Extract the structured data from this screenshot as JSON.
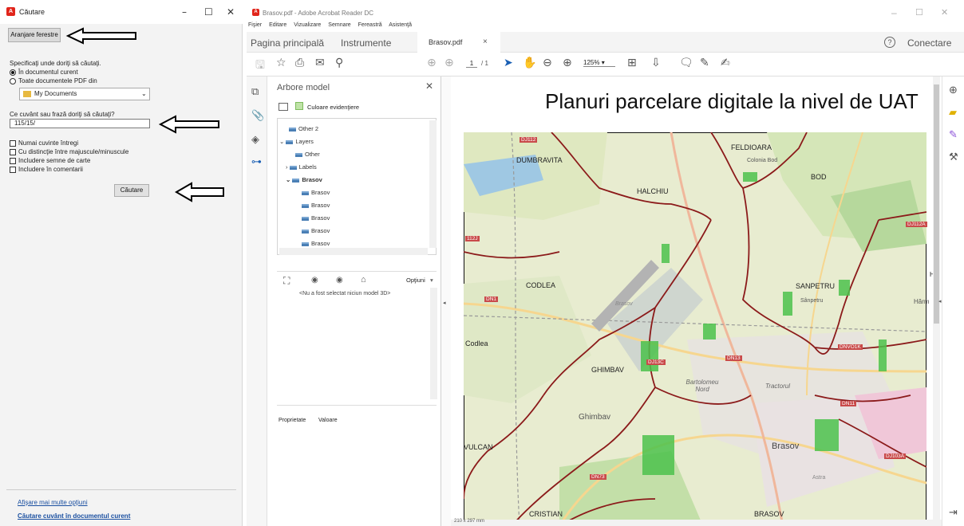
{
  "search": {
    "title": "Căutare",
    "arrange_button": "Aranjare ferestre",
    "where_label": "Specificaţi unde doriţi să căutaţi.",
    "opt_current": "În documentul curent",
    "opt_all_pdfs": "Toate documentele PDF din",
    "folder": "My Documents",
    "query_label": "Ce cuvânt sau frază doriţi să căutaţi?",
    "query_value": "115/15/",
    "chk_whole": "Numai cuvinte întregi",
    "chk_case": "Cu distincţie între majuscule/minuscule",
    "chk_bookmarks": "Includere semne de carte",
    "chk_comments": "Includere în comentarii",
    "search_button": "Căutare",
    "more_options": "Afişare mai multe opţiuni",
    "search_current": "Căutare cuvânt în documentul curent"
  },
  "acrobat": {
    "title": "Brasov.pdf - Adobe Acrobat Reader DC",
    "menu": [
      "Fişier",
      "Editare",
      "Vizualizare",
      "Semnare",
      "Fereastră",
      "Asistenţă"
    ],
    "tabs": {
      "home": "Pagina principală",
      "tools": "Instrumente",
      "doc": "Brasov.pdf",
      "close": "×"
    },
    "help": "?",
    "signin": "Conectare",
    "page_current": "1",
    "page_total": "/ 1",
    "zoom": "125%",
    "page_size": "210 x 297 mm"
  },
  "model_tree": {
    "title": "Arbore model",
    "highlight": "Culoare evidenţiere",
    "items": [
      "Other 2",
      "Layers",
      "Other",
      "Labels",
      "Brasov",
      "Brasov",
      "Brasov",
      "Brasov",
      "Brasov",
      "Brasov"
    ],
    "options": "Opţiuni",
    "no_model": "<Nu a fost selectat niciun model 3D>",
    "prop_col": "Proprietate",
    "val_col": "Valoare"
  },
  "map": {
    "heading": "Planuri parcelare digitale la nivel de UAT",
    "places": [
      "DUMBRAVITA",
      "FELDIOARA",
      "Colonia Bod",
      "BOD",
      "HALCHIU",
      "CODLEA",
      "SANPETRU",
      "Sânpetru",
      "Hărm",
      "HAI",
      "Codlea",
      "GHIMBAV",
      "Bartolomeu Nord",
      "Tractorul",
      "Ghimbav",
      "VULCAN",
      "Brasov",
      "CRISTIAN",
      "BRASOV",
      "Brasov",
      "Astra"
    ],
    "roads": [
      "DJ112",
      "DJ112A",
      "DN1",
      "DN13",
      "DNVO1K",
      "DN11",
      "DN73",
      "DJ103A",
      "112J",
      "DJ13C"
    ]
  }
}
